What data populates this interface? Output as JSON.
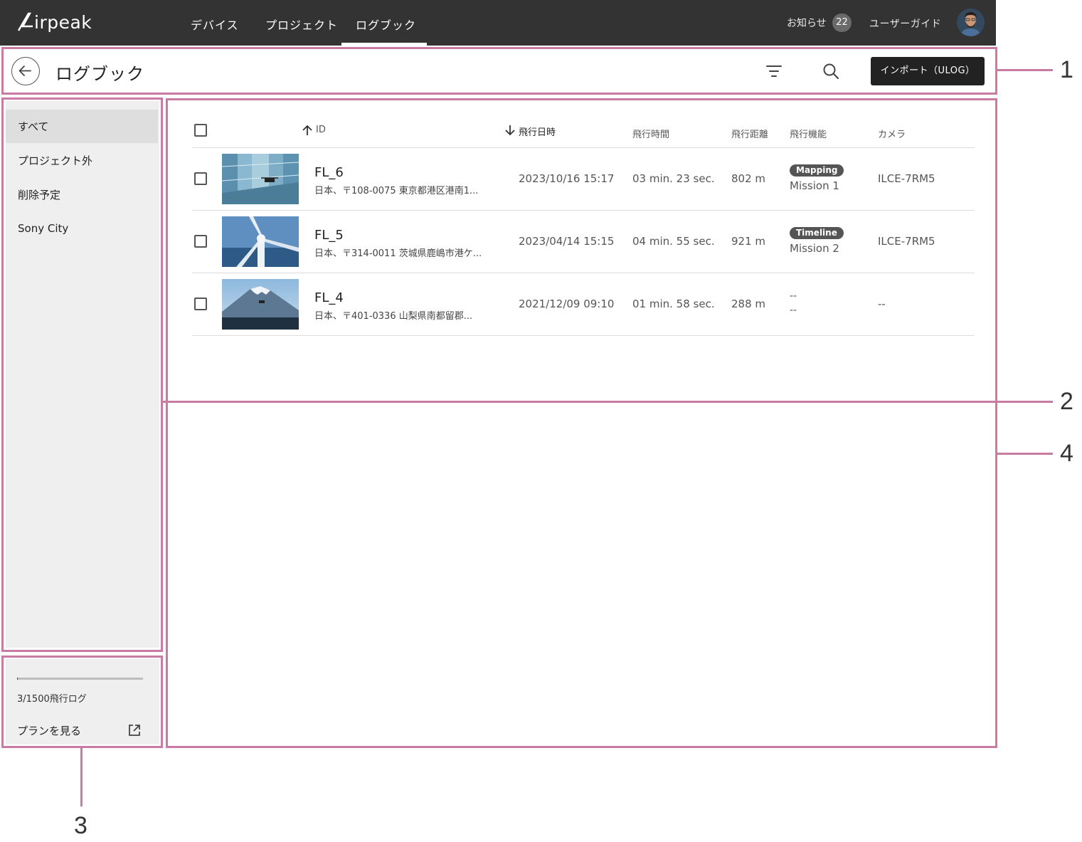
{
  "app": {
    "logo": "Airpeak"
  },
  "nav": {
    "items": [
      {
        "label": "デバイス"
      },
      {
        "label": "プロジェクト"
      },
      {
        "label": "ログブック"
      }
    ],
    "active": "ログブック",
    "notice_label": "お知らせ",
    "notice_count": "22",
    "guide_label": "ユーザーガイド"
  },
  "header": {
    "title": "ログブック",
    "import_label": "インポート（ULOG）"
  },
  "sidebar": {
    "items": [
      {
        "label": "すべて"
      },
      {
        "label": "プロジェクト外"
      },
      {
        "label": "削除予定"
      },
      {
        "label": "Sony City"
      }
    ],
    "selected": "すべて",
    "quota_text": "3/1500飛行ログ",
    "quota_progress": 0.002,
    "plan_label": "プランを見る"
  },
  "table": {
    "headers": {
      "id": "ID",
      "date": "飛行日時",
      "duration": "飛行時間",
      "distance": "飛行距離",
      "function": "飛行機能",
      "camera": "カメラ"
    },
    "rows": [
      {
        "name": "FL_6",
        "address": "日本、〒108-0075 東京都港区港南1...",
        "date": "2023/10/16 15:17",
        "duration": "03 min. 23 sec.",
        "distance": "802 m",
        "tag": "Mapping",
        "mission": "Mission 1",
        "camera": "ILCE-7RM5"
      },
      {
        "name": "FL_5",
        "address": "日本、〒314-0011 茨城県鹿嶋市港ケ...",
        "date": "2023/04/14 15:15",
        "duration": "04 min. 55 sec.",
        "distance": "921 m",
        "tag": "Timeline",
        "mission": "Mission 2",
        "camera": "ILCE-7RM5"
      },
      {
        "name": "FL_4",
        "address": "日本、〒401-0336 山梨県南都留郡...",
        "date": "2021/12/09 09:10",
        "duration": "01 min. 58 sec.",
        "distance": "288 m",
        "tag_placeholder": "--",
        "mission": "--",
        "camera": "--"
      }
    ]
  },
  "callouts": {
    "n1": "1",
    "n2": "2",
    "n3": "3",
    "n4": "4"
  },
  "colors": {
    "accent_callout": "#c87ba3",
    "topbar": "#333333",
    "sidebar": "#efefef"
  }
}
